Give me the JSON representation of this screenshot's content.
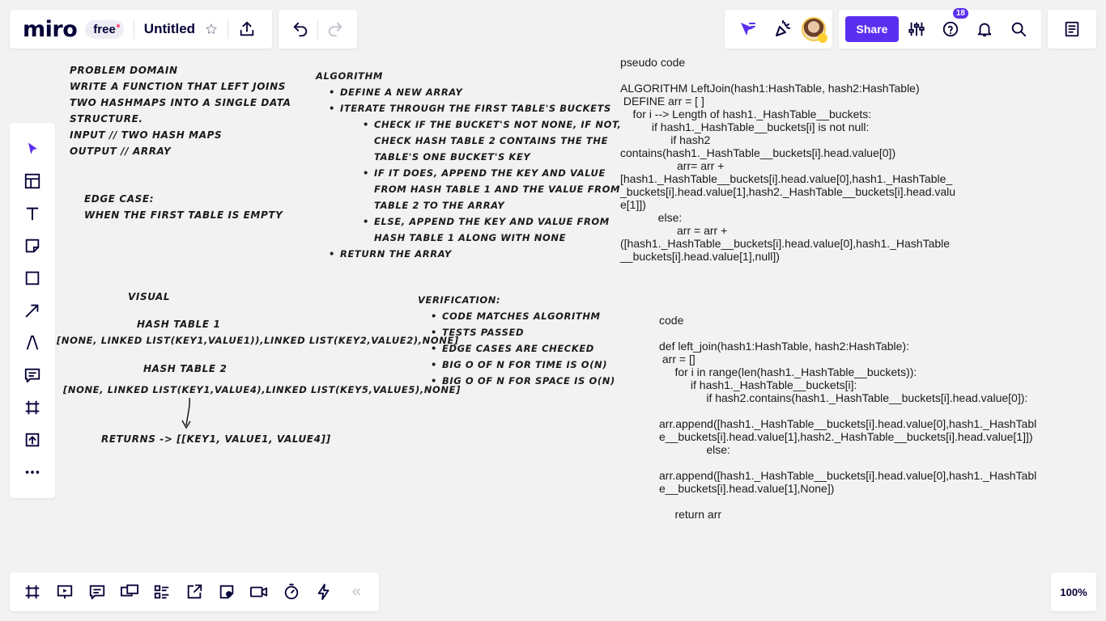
{
  "app": {
    "logo": "miro",
    "plan_badge": "free",
    "board_title": "Untitled",
    "share_label": "Share",
    "help_badge": "18",
    "zoom_level": "100%"
  },
  "icons": {
    "top_left": [
      "star-icon",
      "export-icon"
    ],
    "undo_redo": [
      "undo-icon",
      "redo-icon"
    ],
    "collab": [
      "cursor-follow-icon",
      "celebrate-icon",
      "avatar"
    ],
    "share_bar": [
      "settings-icon",
      "help-icon",
      "bell-icon",
      "search-icon"
    ],
    "left_tools": [
      "select-icon",
      "templates-icon",
      "text-icon",
      "sticky-note-icon",
      "shape-icon",
      "arrow-icon",
      "pen-icon",
      "comment-icon",
      "frame-icon",
      "upload-icon",
      "more-icon"
    ],
    "bottom_tools": [
      "frames-icon",
      "present-icon",
      "comments-panel-icon",
      "video-chat-icon",
      "card-icon",
      "share-screen-icon",
      "board-card-icon",
      "video-icon",
      "timer-icon",
      "bolt-icon",
      "collapse-icon"
    ]
  },
  "canvas": {
    "problem": [
      "PROBLEM DOMAIN",
      "Write a function that left joins",
      "two hashmaps into a single data",
      "structure.",
      "input // two hash maps",
      "output // array"
    ],
    "edge": [
      "Edge case:",
      "when the first table is empty"
    ],
    "algorithm": {
      "title": "ALGORITHM",
      "items": [
        {
          "text": "define a new array",
          "level": 1
        },
        {
          "text": "iterate through the first table's buckets",
          "level": 1
        },
        {
          "text": "check if the bucket's not none, if not,",
          "level": 2
        },
        {
          "text": "check hash table 2 contains the the",
          "level": 3
        },
        {
          "text": "table's one bucket's key",
          "level": 3
        },
        {
          "text": "if it does, append the key and value",
          "level": 2
        },
        {
          "text": "from hash table 1 and the value from",
          "level": 3
        },
        {
          "text": "table 2 to the array",
          "level": 3
        },
        {
          "text": "else, append the key and value from",
          "level": 2
        },
        {
          "text": "hash table 1 along with none",
          "level": 3
        },
        {
          "text": "return the array",
          "level": 1
        }
      ]
    },
    "visual": {
      "title": "visual",
      "t1_label": "hash table 1",
      "t1": "[none, linked list(key1,value1)),linked list(key2,value2),none]",
      "t2_label": "hash table 2",
      "t2": "[none, linked list(key1,value4),linked list(key5,value5),none]",
      "returns": "returns -> [[key1, value1, value4]]"
    },
    "verification": {
      "title": "verification:",
      "items": [
        "code matches algorithm",
        "tests passed",
        "edge cases are checked",
        "big O of n for time is O(n)",
        "big O of n for space is O(n)"
      ]
    },
    "pseudo": "pseudo code\n\nALGORITHM LeftJoin(hash1:HashTable, hash2:HashTable)\n DEFINE arr = [ ]\n    for i --> Length of hash1._HashTable__buckets:\n          if hash1._HashTable__buckets[i] is not null:\n                if hash2\ncontains(hash1._HashTable__buckets[i].head.value[0])\n                  arr= arr +\n[hash1._HashTable__buckets[i].head.value[0],hash1._HashTable_\n_buckets[i].head.value[1],hash2._HashTable__buckets[i].head.valu\ne[1]])\n            else:\n                  arr = arr +\n([hash1._HashTable__buckets[i].head.value[0],hash1._HashTable\n__buckets[i].head.value[1],null])",
    "code": "code\n\ndef left_join(hash1:HashTable, hash2:HashTable):\n arr = []\n     for i in range(len(hash1._HashTable__buckets)):\n          if hash1._HashTable__buckets[i]:\n               if hash2.contains(hash1._HashTable__buckets[i].head.value[0]):\n\narr.append([hash1._HashTable__buckets[i].head.value[0],hash1._HashTabl\ne__buckets[i].head.value[1],hash2._HashTable__buckets[i].head.value[1]])\n               else:\n\narr.append([hash1._HashTable__buckets[i].head.value[0],hash1._HashTabl\ne__buckets[i].head.value[1],None])\n\n     return arr"
  }
}
